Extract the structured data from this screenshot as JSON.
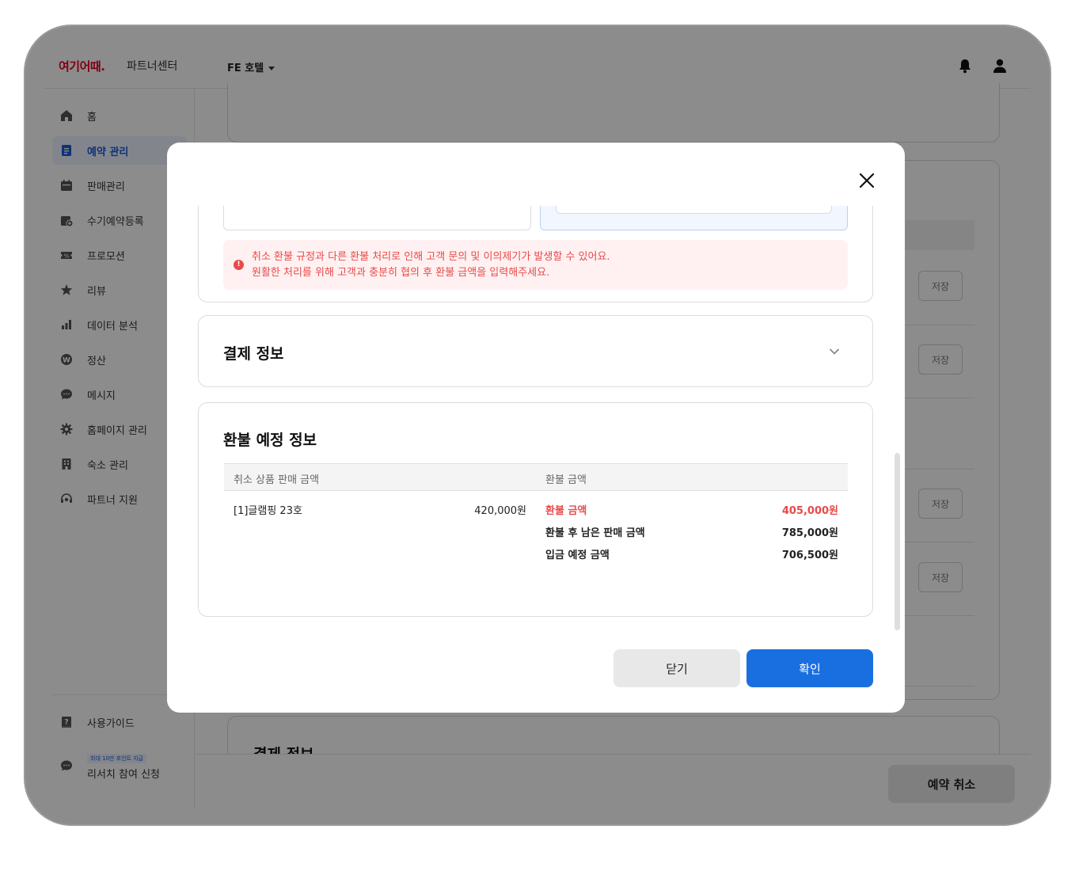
{
  "header": {
    "logo": "여기어때.",
    "logo_sub": "파트너센터",
    "hotel_name": "FE 호텔",
    "bell_icon": "bell-icon",
    "user_icon": "user-icon"
  },
  "sidebar": {
    "items": [
      {
        "label": "홈",
        "icon": "home-icon"
      },
      {
        "label": "예약 관리",
        "icon": "document-icon",
        "active": true
      },
      {
        "label": "판매관리",
        "icon": "calendar-icon"
      },
      {
        "label": "수기예약등록",
        "icon": "calendar-plus-icon"
      },
      {
        "label": "프로모션",
        "icon": "coupon-icon"
      },
      {
        "label": "리뷰",
        "icon": "star-icon"
      },
      {
        "label": "데이터 분석",
        "icon": "bar-chart-icon"
      },
      {
        "label": "정산",
        "icon": "won-icon"
      },
      {
        "label": "메시지",
        "icon": "chat-icon"
      },
      {
        "label": "홈페이지 관리",
        "icon": "gear-icon"
      },
      {
        "label": "숙소 관리",
        "icon": "building-icon"
      },
      {
        "label": "파트너 지원",
        "icon": "headset-icon"
      }
    ],
    "guide_label": "사용가이드",
    "research_badge": "최대 10만 포인트 지급",
    "research_label": "리서치 참여 신청"
  },
  "background": {
    "save_label": "저장",
    "payment_title": "결제 정보",
    "cancel_reservation": "예약 취소"
  },
  "modal": {
    "warning_line1": "취소 환불 규정과 다른 환불 처리로 인해 고객 문의 및 이의제기가 발생할 수 있어요.",
    "warning_line2": "원활한 처리를 위해 고객과 충분히 협의 후 환불 금액을 입력해주세요.",
    "payment_section_title": "결제 정보",
    "refund_section_title": "환불 예정 정보",
    "table": {
      "col_product": "취소 상품 판매 금액",
      "col_refund": "환불 금액",
      "product_name": "[1]글램핑 23호",
      "product_amount": "420,000원",
      "refund_rows": [
        {
          "label": "환불 금액",
          "value": "405,000원",
          "highlight": true
        },
        {
          "label": "환불 후 남은 판매 금액",
          "value": "785,000원"
        },
        {
          "label": "입금 예정 금액",
          "value": "706,500원"
        }
      ]
    },
    "close_label": "닫기",
    "confirm_label": "확인",
    "accent_color": "#1a6fe0",
    "warning_color": "#e84a4a"
  }
}
